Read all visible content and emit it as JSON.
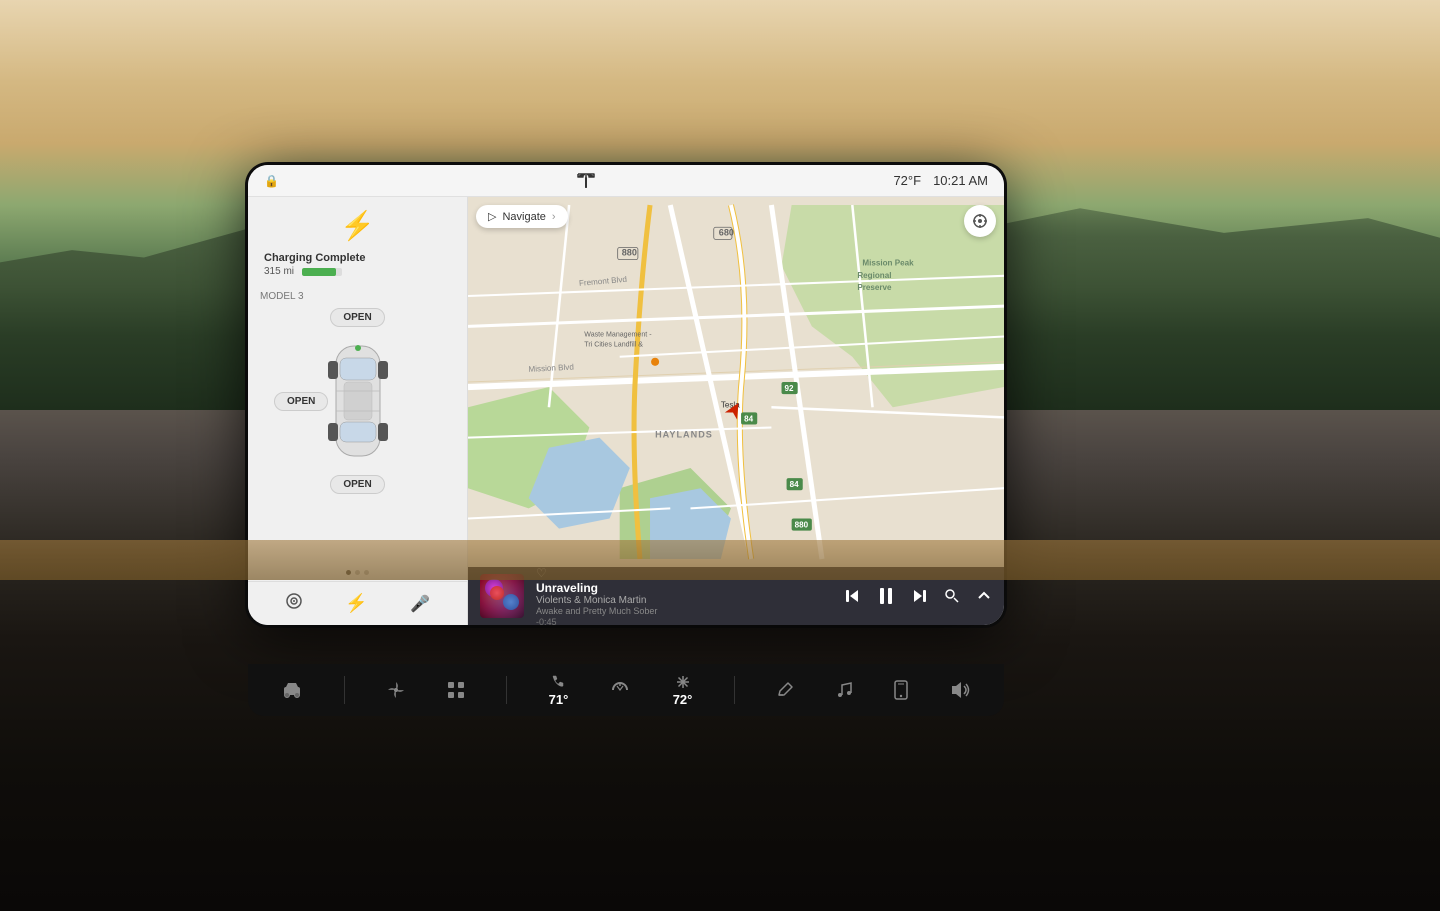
{
  "dashboard": {
    "background_type": "sunset_landscape"
  },
  "status_bar": {
    "temperature": "72°F",
    "time": "10:21 AM",
    "lock_icon": "🔒",
    "tesla_logo": "T"
  },
  "charging": {
    "icon": "⚡",
    "status": "Charging Complete",
    "range": "315 mi",
    "battery_percent": 85,
    "model": "MODEL 3"
  },
  "car_controls": {
    "trunk_button": "OPEN",
    "left_door_button": "OPEN",
    "frunk_button": "OPEN"
  },
  "navigation": {
    "button_label": "Navigate",
    "chevron": "›"
  },
  "map": {
    "location_name": "Tesla",
    "region": "HAYLANDS",
    "preserve": "Mission Peak Regional Preserve"
  },
  "music_player": {
    "song_title": "Unraveling",
    "artist": "Violents & Monica Martin",
    "album": "Awake and Pretty Much Sober",
    "duration": "-0:45",
    "heart_icon": "♡"
  },
  "music_controls": {
    "prev": "⏮",
    "play_pause": "⏸",
    "next": "⏭",
    "search": "🔍",
    "expand": "⌃"
  },
  "taskbar": {
    "items": [
      {
        "icon": "🚗",
        "label": "",
        "active": false
      },
      {
        "icon": "❄",
        "label": "",
        "active": false
      },
      {
        "icon": "⊞",
        "label": "",
        "active": false
      },
      {
        "icon": "📞",
        "label": "71°",
        "active": false
      },
      {
        "icon": "❄",
        "label": "72°",
        "active": false
      },
      {
        "icon": "✎",
        "label": "",
        "active": false
      },
      {
        "icon": "♪",
        "label": "",
        "active": false
      },
      {
        "icon": "📱",
        "label": "",
        "active": false
      },
      {
        "icon": "🔊",
        "label": "",
        "active": false
      }
    ],
    "left_temp": "71°",
    "right_temp": "72°"
  },
  "panel_icons": {
    "camera": "⊙",
    "lightning": "⚡",
    "mic": "🎤"
  }
}
